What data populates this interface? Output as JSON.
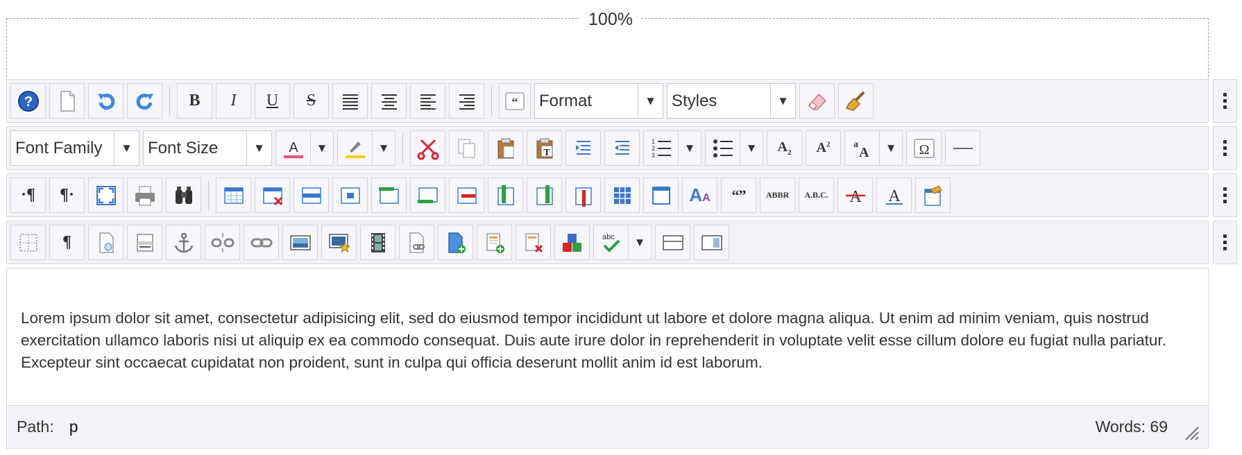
{
  "zoom": "100%",
  "toolbars": {
    "format_label": "Format",
    "styles_label": "Styles",
    "font_family_label": "Font Family",
    "font_size_label": "Font Size",
    "abbr_label": "ABBR",
    "acronym_label": "A.B.C.",
    "quote_label": "“”"
  },
  "content": {
    "text": "Lorem ipsum dolor sit amet, consectetur adipisicing elit, sed do eiusmod tempor incididunt ut labore et dolore magna aliqua. Ut enim ad minim veniam, quis nostrud exercitation ullamco laboris nisi ut aliquip ex ea commodo consequat. Duis aute irure dolor in reprehenderit in voluptate velit esse cillum dolore eu fugiat nulla pariatur. Excepteur sint occaecat cupidatat non proident, sunt in culpa qui officia deserunt mollit anim id est laborum."
  },
  "statusbar": {
    "path_label": "Path:",
    "path_value": "p",
    "words": "Words: 69"
  },
  "colors": {
    "font_color": "#e8507a",
    "highlight": "#f0d020",
    "help_blue": "#2a64c8",
    "accent_blue": "#3a78d0"
  }
}
